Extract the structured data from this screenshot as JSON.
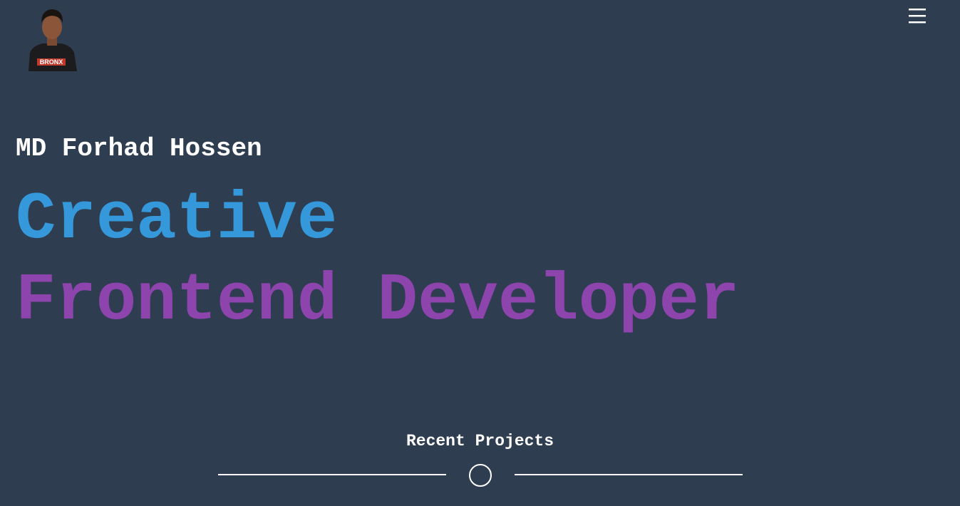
{
  "header": {
    "avatar_shirt_text": "BRONX",
    "menu_icon": "hamburger-menu-icon"
  },
  "hero": {
    "name": "MD Forhad Hossen",
    "line1": "Creative",
    "line2": "Frontend Developer"
  },
  "projects": {
    "title": "Recent Projects",
    "divider_icon": "circle-icon"
  },
  "colors": {
    "background": "#2e3d50",
    "text": "#ffffff",
    "accent_blue": "#3498db",
    "accent_purple": "#8e44ad"
  }
}
